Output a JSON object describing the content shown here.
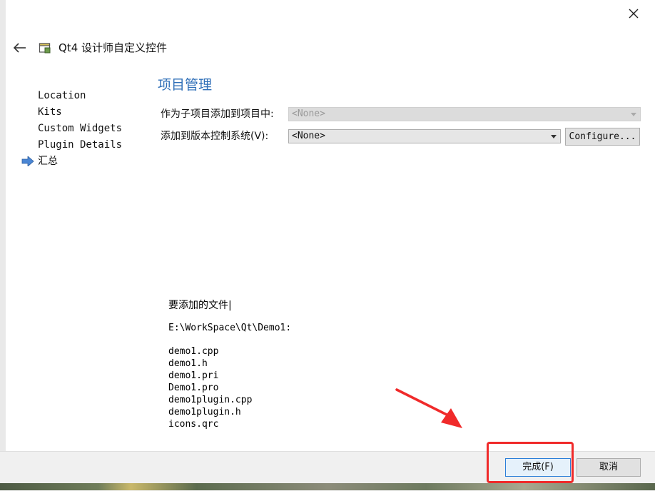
{
  "window": {
    "title": "Qt4 设计师自定义控件",
    "icons": {
      "close": "close-icon",
      "back": "back-arrow-icon",
      "wizard": "wizard-window-icon"
    }
  },
  "steps": {
    "items": [
      {
        "label": "Location"
      },
      {
        "label": "Kits"
      },
      {
        "label": "Custom Widgets"
      },
      {
        "label": "Plugin Details"
      },
      {
        "label": "汇总",
        "current": true
      }
    ],
    "current_indicator_icon": "current-step-arrow-icon"
  },
  "page": {
    "title": "项目管理",
    "add_as_subproject_label": "作为子项目添加到项目中:",
    "add_as_subproject_value": "<None>",
    "version_control_label": "添加到版本控制系统(V):",
    "version_control_value": "<None>",
    "configure_label": "Configure..."
  },
  "files": {
    "heading": "要添加的文件|",
    "directory": "E:\\WorkSpace\\Qt\\Demo1:",
    "list": [
      "demo1.cpp",
      "demo1.h",
      "demo1.pri",
      "Demo1.pro",
      "demo1plugin.cpp",
      "demo1plugin.h",
      "icons.qrc"
    ]
  },
  "buttons": {
    "finish_label": "完成(F)",
    "cancel_label": "取消"
  },
  "colors": {
    "accent_title": "#2f6fb8",
    "annotation_red": "#f02a2a",
    "step_arrow": "#4a86d4"
  }
}
